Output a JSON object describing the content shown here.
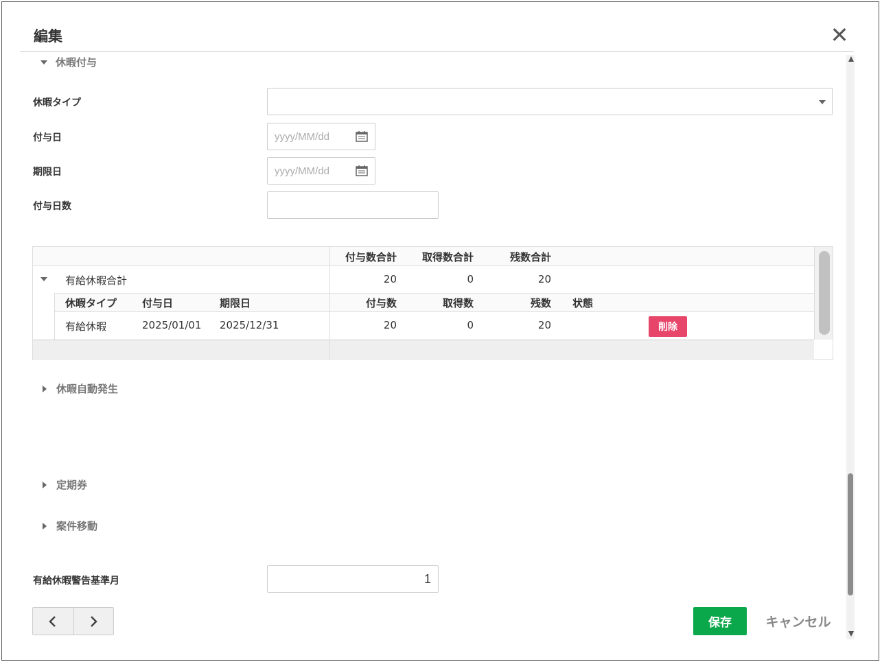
{
  "dialog": {
    "title": "編集",
    "close_icon": "close-icon"
  },
  "sections": {
    "leave_grant": "休暇付与",
    "auto_leave": "休暇自動発生",
    "commuter_pass": "定期券",
    "case_transfer": "案件移動"
  },
  "form": {
    "leave_type_label": "休暇タイプ",
    "leave_type_value": "",
    "grant_date_label": "付与日",
    "grant_date_placeholder": "yyyy/MM/dd",
    "expiry_date_label": "期限日",
    "expiry_date_placeholder": "yyyy/MM/dd",
    "grant_days_label": "付与日数",
    "grant_days_value": "",
    "warning_month_label": "有給休暇警告基準月",
    "warning_month_value": "1"
  },
  "grid": {
    "summary_headers": {
      "granted_total": "付与数合計",
      "taken_total": "取得数合計",
      "remaining_total": "残数合計"
    },
    "group": {
      "name": "有給休暇合計",
      "granted_total": "20",
      "taken_total": "0",
      "remaining_total": "20"
    },
    "detail_headers": {
      "leave_type": "休暇タイプ",
      "grant_date": "付与日",
      "expiry_date": "期限日",
      "granted": "付与数",
      "taken": "取得数",
      "remaining": "残数",
      "status": "状態"
    },
    "rows": [
      {
        "leave_type": "有給休暇",
        "grant_date": "2025/01/01",
        "expiry_date": "2025/12/31",
        "granted": "20",
        "taken": "0",
        "remaining": "20",
        "status": "",
        "delete_label": "削除"
      }
    ]
  },
  "footer": {
    "prev_icon": "chevron-left-icon",
    "next_icon": "chevron-right-icon",
    "save_label": "保存",
    "cancel_label": "キャンセル"
  },
  "colors": {
    "save": "#0aa84a",
    "delete": "#e8456a"
  }
}
